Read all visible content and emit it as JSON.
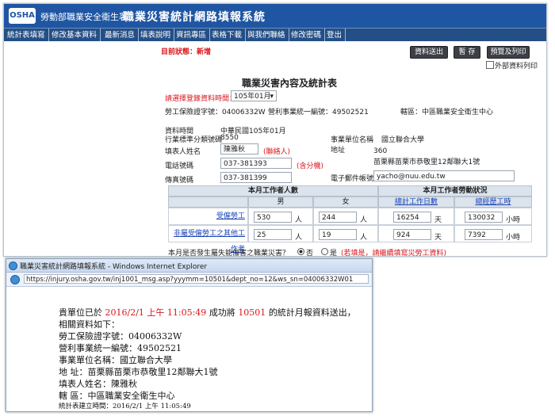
{
  "app": {
    "logo_text": "OSHA",
    "agency": "勞動部職業安全衛生署",
    "system_name": "職業災害統計網路填報系統"
  },
  "menu": [
    "統計表填寫",
    "修改基本資料",
    "最新消息",
    "填表說明",
    "資訊專區",
    "表格下載",
    "與我們聯絡",
    "修改密碼",
    "登出"
  ],
  "status": {
    "label": "目前狀態：新增"
  },
  "toolbar": {
    "submit": "資料送出",
    "save": "暫 存",
    "preview_print": "預覽及列印",
    "external_print": "外部資料列印"
  },
  "form": {
    "title": "職業災害內容及統計表",
    "period_prompt": "請選擇登錄資料時間：",
    "period_value": "105年01月",
    "insurance_label": "勞工保險證字號：04006332W",
    "business_id_label": "營利事業統一編號：49502521",
    "district_label": "轄區：中區職業安全衛生中心",
    "data_time_label": "資料時間",
    "data_time_value": "中華民國105年01月",
    "industry_code_label": "行業標準分類號碼",
    "industry_code_value": "8550",
    "unit_name_label": "事業單位名稱",
    "unit_name_value": "國立聯合大學",
    "filler_label": "填表人姓名",
    "filler_value": "陳雅秋",
    "filler_hint": "(聯絡人)",
    "address_label": "地址",
    "address_zip": "360",
    "address_value": "苗栗縣苗栗市恭敬里12鄰聯大1號",
    "phone_label": "電話號碼",
    "phone_value": "037-381393",
    "phone_hint": "(含分機)",
    "fax_label": "傳真號碼",
    "fax_value": "037-381399",
    "email_label": "電子郵件帳號",
    "email_value": "yacho@nuu.edu.tw",
    "workers_header": "本月工作者人數",
    "hours_header": "本月工作者勞動狀況",
    "male": "男",
    "female": "女",
    "total_work_days": "總計工作日數",
    "total_work_hours": "總經歷工時",
    "rows": [
      {
        "label": "受僱勞工",
        "male": "530",
        "female": "244",
        "days": "16254",
        "hours": "130032"
      },
      {
        "label": "非屬受僱勞工之其他工作者",
        "male": "25",
        "female": "19",
        "days": "924",
        "hours": "7392"
      }
    ],
    "unit_person": "人",
    "unit_day": "天",
    "unit_hour": "小時",
    "disaster_question": "本月是否發生屬失能傷害之職業災害？",
    "option_no": "否",
    "option_yes": "是",
    "disaster_hint": "(若填是，請繼續填寫災勞工資料)"
  },
  "ie": {
    "title": "職業災害統計網路填報系統 - Windows Internet Explorer",
    "url": "https://injury.osha.gov.tw/inj1001_msg.asp?yyymm=10501&dept_no=12&ws_sn=04006332W01"
  },
  "message": {
    "line1_pre": "貴單位已於",
    "line1_time": "2016/2/1 上午 11:05:49",
    "line1_mid": "成功將",
    "line1_period": "10501",
    "line1_post": "的統計月報資料送出，",
    "line2": "相關資料如下：",
    "line3": "勞工保險證字號：04006332W",
    "line4": "營利事業統一編號：49502521",
    "line5": "事業單位名稱：國立聯合大學",
    "line6": "地 址：苗栗縣苗栗市恭敬里12鄰聯大1號",
    "line7": "填表人姓名：陳雅秋",
    "line8": "轄 區：中區職業安全衛生中心",
    "line9": "統計表建立時間：2016/2/1 上午 11:05:49"
  },
  "colors": {
    "banner": "#1f56a3",
    "menubar": "#244f86",
    "alert_red": "#d8161b",
    "link_blue": "#1a44b8"
  }
}
